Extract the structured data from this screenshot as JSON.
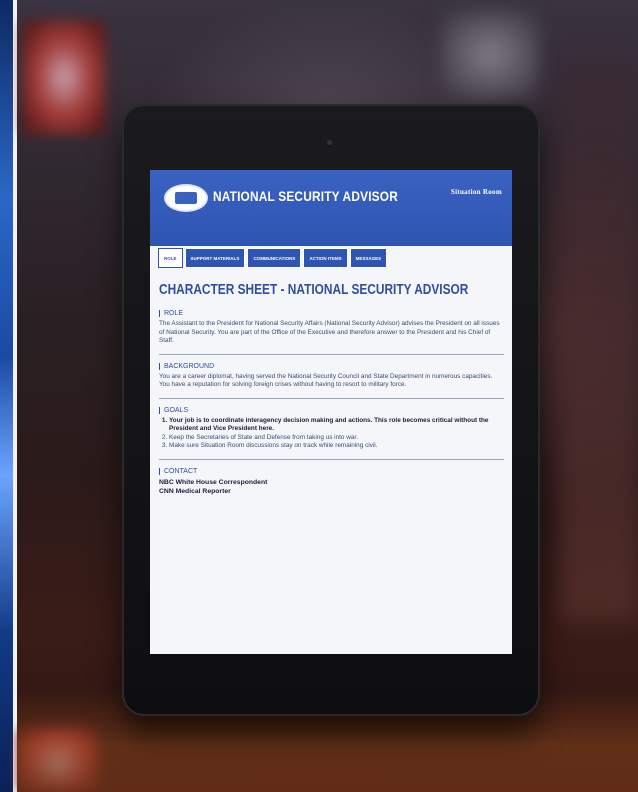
{
  "app": {
    "title": "NATIONAL SECURITY ADVISOR",
    "brand": "Situation Room"
  },
  "tabs": [
    {
      "label": "ROLE",
      "active": true
    },
    {
      "label": "SUPPORT MATERIALS",
      "active": false
    },
    {
      "label": "COMMUNICATIONS",
      "active": false
    },
    {
      "label": "ACTION ITEMS",
      "active": false
    },
    {
      "label": "MESSAGES",
      "active": false
    }
  ],
  "sheet": {
    "title": "CHARACTER SHEET - NATIONAL SECURITY ADVISOR",
    "role": {
      "heading": "ROLE",
      "text": "The Assistant to the President for National Security Affairs (National Security Advisor) advises the President on all issues of National Security. You are part of the Office of the Executive and therefore answer to the President and his Chief of Staff."
    },
    "background": {
      "heading": "BACKGROUND",
      "text": "You are a career diplomat, having served the National Security Council and State Department in numerous capacities. You have a reputation for solving foreign crises without having to resort to military force."
    },
    "goals": {
      "heading": "GOALS",
      "items": [
        "Your job is to coordinate interagency decision making and actions. This role becomes critical without the President and Vice President here.",
        "Keep the Secretaries of State and Defense from taking us into war.",
        "Make sure Situation Room discussions stay on track while remaining civil."
      ]
    },
    "contact": {
      "heading": "CONTACT",
      "lines": [
        "NBC White House Correspondent",
        "CNN Medical Reporter"
      ]
    }
  },
  "colors": {
    "header_blue": "#2f55b3",
    "title_blue": "#2d4f9e",
    "screen_bg": "#f4f6fa"
  }
}
